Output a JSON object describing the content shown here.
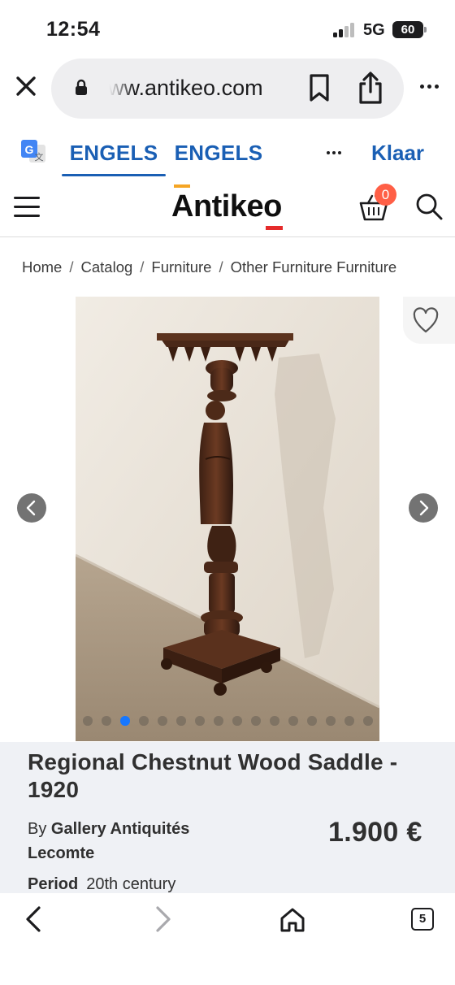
{
  "status_bar": {
    "time": "12:54",
    "network": "5G",
    "battery": "60"
  },
  "browser": {
    "url": "ww.antikeo.com"
  },
  "translate_bar": {
    "source_lang": "ENGELS",
    "target_lang": "ENGELS",
    "done_label": "Klaar"
  },
  "site_header": {
    "logo": "Antikeo",
    "cart_count": "0"
  },
  "breadcrumb": [
    "Home",
    "Catalog",
    "Furniture",
    "Other Furniture Furniture"
  ],
  "gallery": {
    "image_count": 16,
    "active_index": 2
  },
  "product": {
    "title": "Regional Chestnut Wood Saddle - 1920",
    "seller_prefix": "By",
    "seller_name": "Gallery Antiquités Lecomte",
    "price": "1.900 €",
    "period_label": "Period",
    "period_value": "20th century"
  },
  "toolbar": {
    "tabs_count": "5"
  },
  "colors": {
    "accent_blue": "#1a5fb4",
    "badge": "#ff5f46",
    "logo_orange": "#f5a524",
    "logo_red": "#e52b2b",
    "dot_active": "#1677ff",
    "panel_bg": "#eff1f5"
  }
}
